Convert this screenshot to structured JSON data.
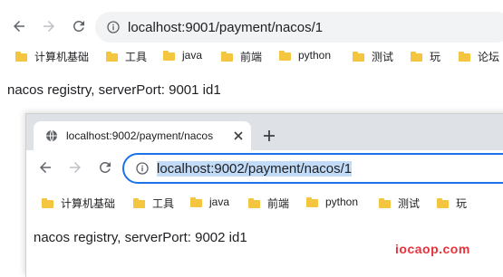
{
  "window1": {
    "url": "localhost:9001/payment/nacos/1",
    "bookmarks": [
      "计算机基础",
      "工具",
      "java",
      "前端",
      "python",
      "测试",
      "玩",
      "论坛"
    ],
    "page_text": "nacos registry, serverPort: 9001 id1"
  },
  "window2": {
    "tab_title": "localhost:9002/payment/nacos",
    "url": "localhost:9002/payment/nacos/1",
    "bookmarks": [
      "计算机基础",
      "工具",
      "java",
      "前端",
      "python",
      "测试",
      "玩"
    ],
    "page_text": "nacos registry, serverPort: 9002 id1"
  },
  "watermark": "iocaop.com",
  "colors": {
    "accent": "#1a73e8",
    "selection": "#c2dbf7",
    "folder": "#f4c53e",
    "watermark": "#e8323a"
  },
  "icons": {
    "back": "arrow-left-icon",
    "forward": "arrow-right-icon",
    "reload": "reload-icon",
    "info": "info-icon",
    "folder": "folder-icon",
    "globe": "globe-icon",
    "close": "close-icon",
    "new_tab": "plus-icon"
  }
}
